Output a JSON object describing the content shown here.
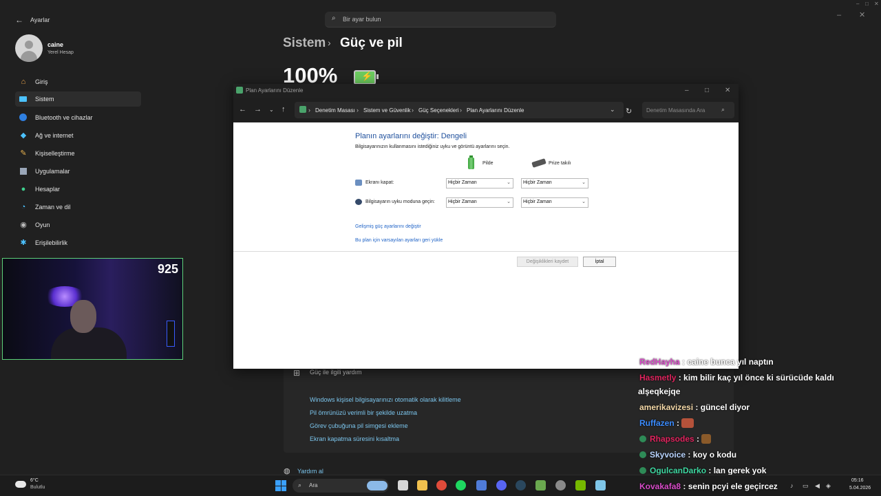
{
  "settings": {
    "app_title": "Ayarlar",
    "search_placeholder": "Bir ayar bulun",
    "user": {
      "name": "caine",
      "account_type": "Yerel Hesap"
    },
    "nav": [
      {
        "label": "Giriş",
        "icon": "home-icon"
      },
      {
        "label": "Sistem",
        "icon": "system-icon",
        "active": true
      },
      {
        "label": "Bluetooth ve cihazlar",
        "icon": "bluetooth-icon"
      },
      {
        "label": "Ağ ve internet",
        "icon": "wifi-icon"
      },
      {
        "label": "Kişiselleştirme",
        "icon": "brush-icon"
      },
      {
        "label": "Uygulamalar",
        "icon": "apps-icon"
      },
      {
        "label": "Hesaplar",
        "icon": "person-icon"
      },
      {
        "label": "Zaman ve dil",
        "icon": "globe-clock-icon"
      },
      {
        "label": "Oyun",
        "icon": "gamepad-icon"
      },
      {
        "label": "Erişilebilirlik",
        "icon": "accessibility-icon"
      }
    ],
    "breadcrumb": {
      "parent": "Sistem",
      "separator": "›",
      "current": "Güç ve pil"
    },
    "battery_percent": "100%",
    "help": {
      "title": "Güç ile ilgili yardım",
      "links": [
        "Windows kişisel bilgisayarınızı otomatik olarak kilitleme",
        "Pil ömrünüzü verimli bir şekilde uzatma",
        "Görev çubuğuna pil simgesi ekleme",
        "Ekran kapatma süresini kısaltma"
      ]
    },
    "get_help": "Yardım al"
  },
  "dialog": {
    "title": "Plan Ayarlarını Düzenle",
    "address": [
      "Denetim Masası",
      "Sistem ve Güvenlik",
      "Güç Seçenekleri",
      "Plan Ayarlarını Düzenle"
    ],
    "search_placeholder": "Denetim Masasında Ara",
    "plan_title": "Planın ayarlarını değiştir: Dengeli",
    "plan_description": "Bilgisayarınızın kullanmasını istediğiniz uyku ve görüntü ayarlarını seçin.",
    "col_battery": "Pilde",
    "col_plugged": "Prize takılı",
    "rows": [
      {
        "label": "Ekranı kapat:",
        "battery": "Hiçbir Zaman",
        "plugged": "Hiçbir Zaman"
      },
      {
        "label": "Bilgisayarın uyku moduna geçin:",
        "battery": "Hiçbir Zaman",
        "plugged": "Hiçbir Zaman"
      }
    ],
    "advanced_link": "Gelişmiş güç ayarlarını değiştir",
    "restore_link": "Bu plan için varsayılan ayarları geri yükle",
    "save_button": "Değişiklikleri kaydet",
    "cancel_button": "İptal"
  },
  "webcam": {
    "count": "925"
  },
  "chat": [
    {
      "user": "RedHayha",
      "color": "#d94cc9",
      "message": ": caine bunca yıl naptın"
    },
    {
      "user": "Hasmetly",
      "color": "#e0245e",
      "message": ": kim bilir kaç yıl önce ki sürücüde kaldı",
      "cont": "alşeqkejqe"
    },
    {
      "user": "amerikavizesi",
      "color": "#f5d9a8",
      "message": ": güncel diyor"
    },
    {
      "user": "Ruffazen",
      "color": "#3b8cff",
      "message": ":",
      "emote": true
    },
    {
      "user": "Rhapsodes",
      "color": "#e0245e",
      "message": ":",
      "emote": true,
      "badge": true
    },
    {
      "user": "Skyvoice",
      "color": "#b9d4ff",
      "message": ": koy o kodu",
      "badge": true
    },
    {
      "user": "OgulcanDarko",
      "color": "#3ed6a0",
      "message": ": lan gerek yok",
      "badge": true
    },
    {
      "user": "Kovakafa8",
      "color": "#d94cc9",
      "message": ": senin pcyi ele geçircez"
    }
  ],
  "taskbar": {
    "weather_temp": "6°C",
    "weather_desc": "Bulutlu",
    "search_label": "Ara",
    "time": "05:16",
    "date": "5.04.2026"
  }
}
